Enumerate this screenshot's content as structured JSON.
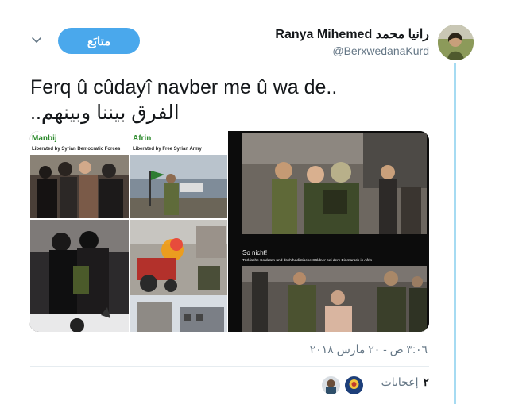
{
  "tweet": {
    "display_name": "Ranya Mihemed رانيا محمد",
    "handle": "@BerxwedanaKurd",
    "follow_label": "متابَع",
    "text_line1": "Ferq û cûdayî navber me û wa de..",
    "text_line2": "الفرق بيننا وبينهم..",
    "timestamp": "٣:٠٦ ص - ٢٠ مارس ٢٠١٨",
    "likes_count": "٢",
    "likes_label": "إعجابات"
  },
  "media": {
    "left_panel_1_title": "Manbij",
    "left_panel_1_subtitle": "Liberated by Syrian Democratic Forces",
    "left_panel_2_title": "Afrin",
    "left_panel_2_subtitle": "Liberated by Free Syrian Army",
    "right_caption_title": "So nicht!",
    "right_caption_subtitle": "Türkische Soldaten und dschihadistische Söldner bei dem Einmarsch in Afrin"
  },
  "colors": {
    "accent": "#4aa8ec",
    "thread_line": "#a6dbf2",
    "manbij_title": "#2e8b2e",
    "afrin_title": "#2e8b2e"
  },
  "icons": {
    "chevron": "chevron-down-icon"
  }
}
